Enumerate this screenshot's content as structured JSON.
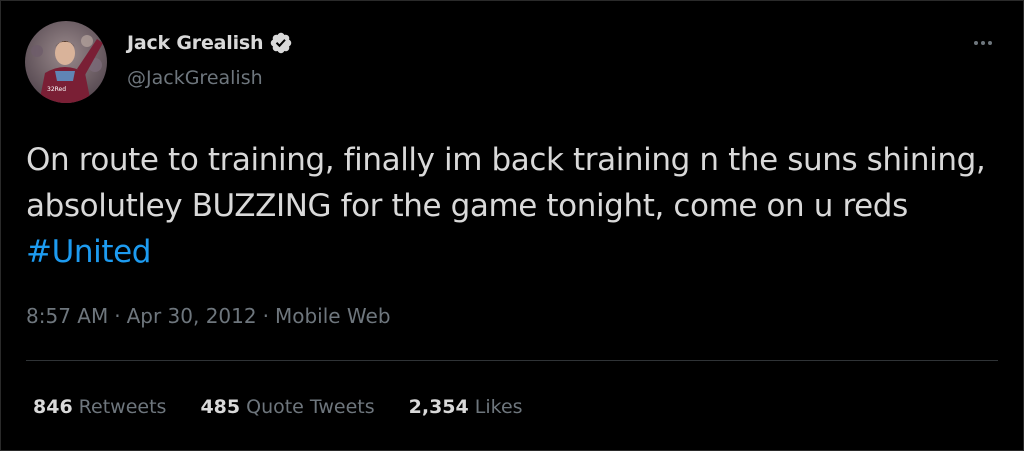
{
  "user": {
    "display_name": "Jack Grealish",
    "handle": "@JackGrealish",
    "verified_icon": "verified-badge-icon"
  },
  "menu": {
    "icon": "more-options-icon"
  },
  "tweet": {
    "text": "On route to training, finally im back training n the suns shining, absolutley BUZZING for the game tonight, come on u reds ",
    "hashtag": "#United",
    "time": "8:57 AM",
    "separator": "·",
    "date": "Apr 30, 2012",
    "source": "Mobile Web"
  },
  "stats": {
    "retweets_count": "846",
    "retweets_label": "Retweets",
    "quotes_count": "485",
    "quotes_label": "Quote Tweets",
    "likes_count": "2,354",
    "likes_label": "Likes"
  },
  "colors": {
    "background": "#000000",
    "text": "#d9d9d9",
    "secondary": "#6e767d",
    "accent": "#1d9bf0",
    "divider": "#2f3336"
  }
}
